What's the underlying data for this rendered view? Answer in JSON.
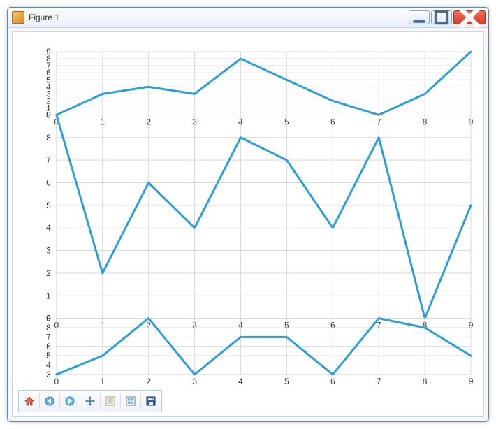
{
  "window": {
    "title": "Figure 1"
  },
  "toolbar": {
    "home": "Home",
    "back": "Back",
    "forward": "Forward",
    "pan": "Pan",
    "zoom": "Zoom",
    "subplots": "Configure subplots",
    "save": "Save"
  },
  "colors": {
    "series": "#2e9fd6",
    "grid": "#d9d9d9"
  },
  "chart_data": [
    {
      "type": "line",
      "position": "top",
      "x": [
        0,
        1,
        2,
        3,
        4,
        5,
        6,
        7,
        8,
        9
      ],
      "values": [
        0,
        3,
        4,
        3,
        8,
        5,
        2,
        0,
        3,
        9
      ],
      "xlim": [
        0,
        9
      ],
      "ylim": [
        0,
        9
      ],
      "xticks": [
        0,
        1,
        2,
        3,
        4,
        5,
        6,
        7,
        8,
        9
      ],
      "yticks": [
        0,
        1,
        2,
        3,
        4,
        5,
        6,
        7,
        8,
        9
      ],
      "grid": true
    },
    {
      "type": "line",
      "position": "middle",
      "x": [
        0,
        1,
        2,
        3,
        4,
        5,
        6,
        7,
        8,
        9
      ],
      "values": [
        9,
        2,
        6,
        4,
        8,
        7,
        4,
        8,
        0,
        5
      ],
      "xlim": [
        0,
        9
      ],
      "ylim": [
        0,
        9
      ],
      "xticks": [
        0,
        1,
        2,
        3,
        4,
        5,
        6,
        7,
        8,
        9
      ],
      "yticks": [
        0,
        1,
        2,
        3,
        4,
        5,
        6,
        7,
        8,
        9
      ],
      "grid": true
    },
    {
      "type": "line",
      "position": "bottom",
      "x": [
        0,
        1,
        2,
        3,
        4,
        5,
        6,
        7,
        8,
        9
      ],
      "values": [
        3,
        5,
        9,
        3,
        7,
        7,
        3,
        9,
        8,
        5
      ],
      "xlim": [
        0,
        9
      ],
      "ylim": [
        3,
        9
      ],
      "xticks": [
        0,
        1,
        2,
        3,
        4,
        5,
        6,
        7,
        8,
        9
      ],
      "yticks": [
        3,
        4,
        5,
        6,
        7,
        8,
        9
      ],
      "grid": true
    }
  ]
}
